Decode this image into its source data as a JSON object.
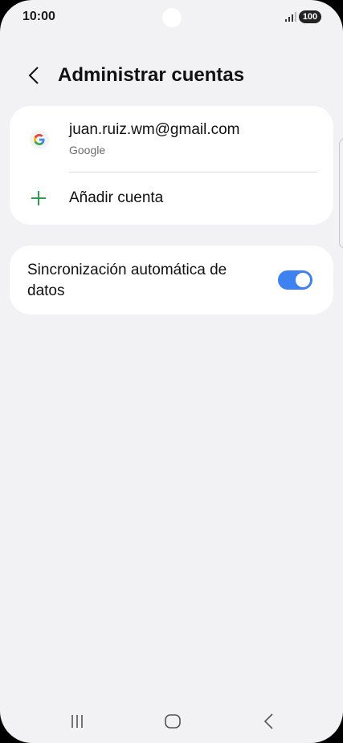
{
  "status_bar": {
    "time": "10:00",
    "battery": "100"
  },
  "header": {
    "title": "Administrar cuentas"
  },
  "accounts": {
    "items": [
      {
        "email": "juan.ruiz.wm@gmail.com",
        "provider": "Google",
        "icon": "google-icon"
      }
    ],
    "add_label": "Añadir cuenta"
  },
  "sync": {
    "label": "Sincronización automática de datos",
    "enabled": true
  },
  "colors": {
    "accent": "#3e82f1",
    "plus_green": "#2e9e4e",
    "background": "#f2f2f4"
  },
  "nav": {
    "icons": [
      "recent-apps-icon",
      "home-icon",
      "back-icon"
    ]
  }
}
